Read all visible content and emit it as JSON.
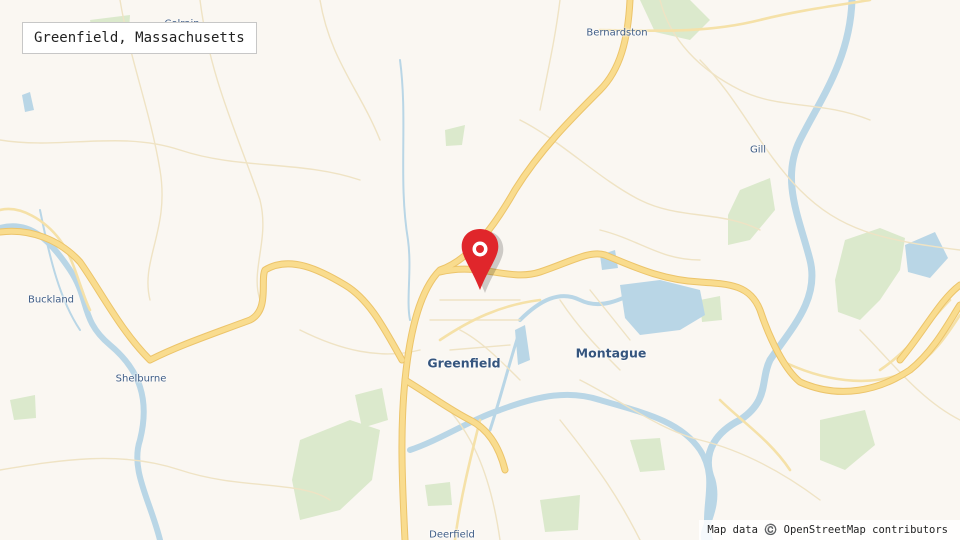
{
  "title": "Greenfield, Massachusetts",
  "attribution": "Map data ©️ OpenStreetMap contributors",
  "places": {
    "greenfield": "Greenfield",
    "montague": "Montague",
    "bernardston": "Bernardston",
    "gill": "Gill",
    "buckland": "Buckland",
    "shelburne": "Shelburne",
    "deerfield": "Deerfield",
    "colrain": "Colrain"
  },
  "marker": {
    "icon": "map-pin-icon",
    "color": "#e0262b"
  },
  "colors": {
    "land": "#faf7f2",
    "water": "#b9d6e6",
    "park": "#dbe9cc",
    "highway": "#f7d98a",
    "road": "#efe3c4"
  }
}
